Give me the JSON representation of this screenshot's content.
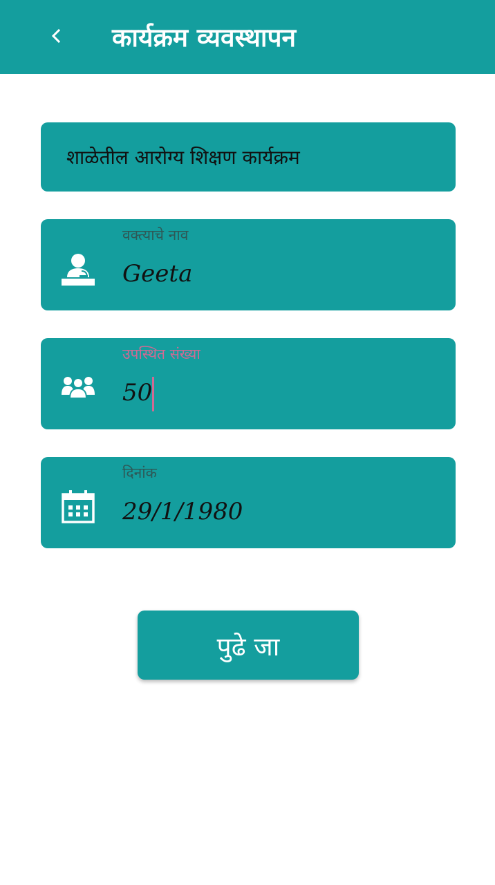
{
  "appbar": {
    "title": "कार्यक्रम व्यवस्थापन",
    "back_icon": "chevron-left-icon"
  },
  "program": {
    "name": "शाळेतील आरोग्य शिक्षण कार्यक्रम"
  },
  "fields": {
    "speaker": {
      "label": "वक्त्याचे नाव",
      "value": "Geeta",
      "icon": "speaker-podium-icon"
    },
    "attendance": {
      "label": "उपस्थित संख्या",
      "value": "50",
      "icon": "group-people-icon"
    },
    "date": {
      "label": "दिनांक",
      "value": "29/1/1980",
      "icon": "calendar-icon"
    }
  },
  "next_button": {
    "label": "पुढे जा"
  },
  "colors": {
    "primary": "#149e9e",
    "focus_accent": "#d06a93",
    "label": "#2e5856",
    "text": "#111111"
  }
}
